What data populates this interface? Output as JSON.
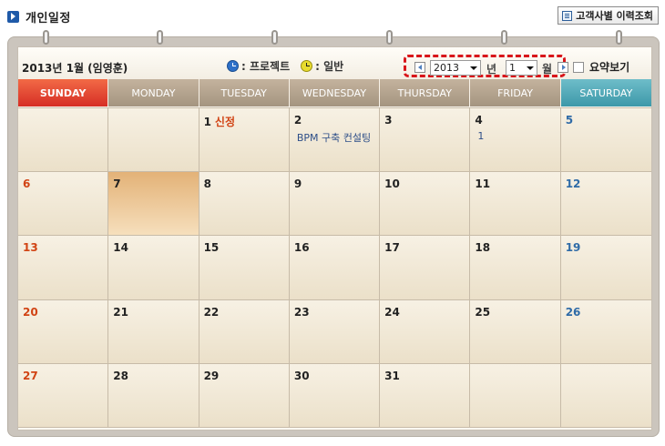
{
  "page": {
    "title": "개인일정",
    "history_button_label": "고객사별 이력조회"
  },
  "toolbar": {
    "month_title": "2013년 1월 (임영훈)",
    "legend_project": ": 프로젝트",
    "legend_general": ": 일반",
    "year_value": "2013",
    "year_unit": "년",
    "month_value": "1",
    "month_unit": "월",
    "summary_label": "요약보기"
  },
  "weekdays": [
    "SUNDAY",
    "MONDAY",
    "TUESDAY",
    "WEDNESDAY",
    "THURSDAY",
    "FRIDAY",
    "SATURDAY"
  ],
  "weeks": [
    [
      {
        "day": "",
        "note": "",
        "event": ""
      },
      {
        "day": "",
        "note": "",
        "event": ""
      },
      {
        "day": "1",
        "note": "신정",
        "event": ""
      },
      {
        "day": "2",
        "note": "",
        "event": "BPM 구축 컨설팅"
      },
      {
        "day": "3",
        "note": "",
        "event": ""
      },
      {
        "day": "4",
        "note": "",
        "event": "1"
      },
      {
        "day": "5",
        "note": "",
        "event": ""
      }
    ],
    [
      {
        "day": "6",
        "note": "",
        "event": ""
      },
      {
        "day": "7",
        "note": "",
        "event": "",
        "today": true
      },
      {
        "day": "8",
        "note": "",
        "event": ""
      },
      {
        "day": "9",
        "note": "",
        "event": ""
      },
      {
        "day": "10",
        "note": "",
        "event": ""
      },
      {
        "day": "11",
        "note": "",
        "event": ""
      },
      {
        "day": "12",
        "note": "",
        "event": ""
      }
    ],
    [
      {
        "day": "13",
        "note": "",
        "event": ""
      },
      {
        "day": "14",
        "note": "",
        "event": ""
      },
      {
        "day": "15",
        "note": "",
        "event": ""
      },
      {
        "day": "16",
        "note": "",
        "event": ""
      },
      {
        "day": "17",
        "note": "",
        "event": ""
      },
      {
        "day": "18",
        "note": "",
        "event": ""
      },
      {
        "day": "19",
        "note": "",
        "event": ""
      }
    ],
    [
      {
        "day": "20",
        "note": "",
        "event": ""
      },
      {
        "day": "21",
        "note": "",
        "event": ""
      },
      {
        "day": "22",
        "note": "",
        "event": ""
      },
      {
        "day": "23",
        "note": "",
        "event": ""
      },
      {
        "day": "24",
        "note": "",
        "event": ""
      },
      {
        "day": "25",
        "note": "",
        "event": ""
      },
      {
        "day": "26",
        "note": "",
        "event": ""
      }
    ],
    [
      {
        "day": "27",
        "note": "",
        "event": ""
      },
      {
        "day": "28",
        "note": "",
        "event": ""
      },
      {
        "day": "29",
        "note": "",
        "event": ""
      },
      {
        "day": "30",
        "note": "",
        "event": ""
      },
      {
        "day": "31",
        "note": "",
        "event": ""
      },
      {
        "day": "",
        "note": "",
        "event": ""
      },
      {
        "day": "",
        "note": "",
        "event": ""
      }
    ]
  ],
  "colors": {
    "sunday_header": "#d62e25",
    "saturday_header": "#3d98a9",
    "weekday_header": "#a49580",
    "today_highlight": "#e3b277",
    "holiday_text": "#d14415",
    "saturday_text": "#2f6ba7",
    "nav_highlight_border": "#d8151a"
  }
}
